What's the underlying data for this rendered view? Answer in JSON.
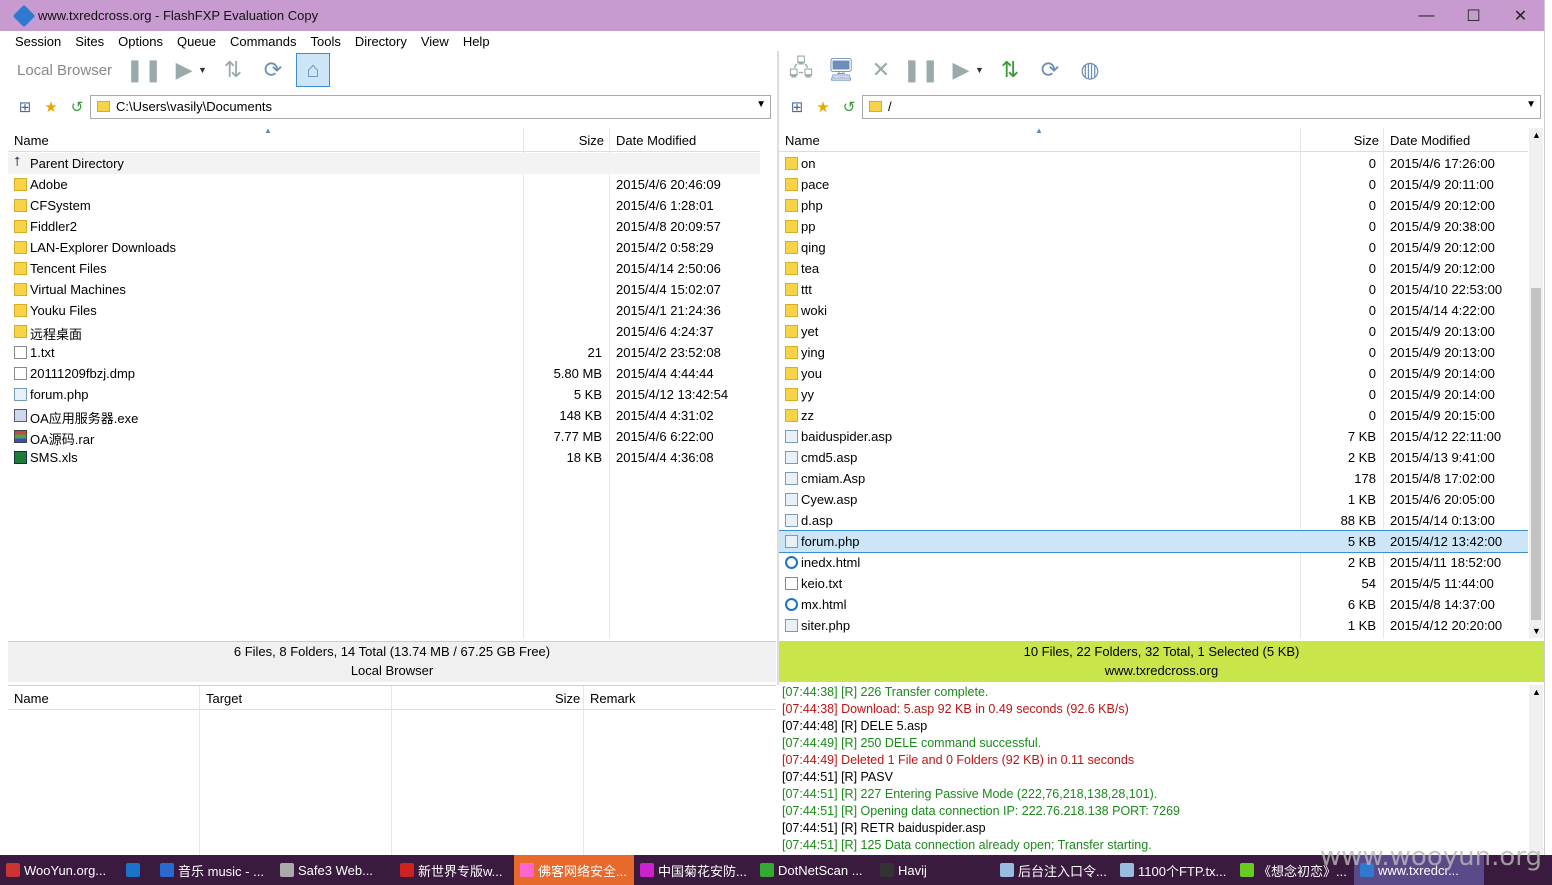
{
  "window": {
    "title": "www.txredcross.org - FlashFXP Evaluation Copy",
    "controls": [
      "—",
      "☐",
      "✕"
    ]
  },
  "menu": [
    "Session",
    "Sites",
    "Options",
    "Queue",
    "Commands",
    "Tools",
    "Directory",
    "View",
    "Help"
  ],
  "left_toolbar": {
    "label": "Local Browser"
  },
  "left_path": "C:\\Users\\vasily\\Documents",
  "right_path": "/",
  "columns": {
    "name": "Name",
    "size": "Size",
    "date": "Date Modified"
  },
  "left_files": [
    {
      "icon": "up",
      "name": "Parent Directory",
      "size": "",
      "date": ""
    },
    {
      "icon": "folder",
      "name": "Adobe",
      "size": "",
      "date": "2015/4/6 20:46:09"
    },
    {
      "icon": "folder",
      "name": "CFSystem",
      "size": "",
      "date": "2015/4/6 1:28:01"
    },
    {
      "icon": "folder",
      "name": "Fiddler2",
      "size": "",
      "date": "2015/4/8 20:09:57"
    },
    {
      "icon": "folder",
      "name": "LAN-Explorer Downloads",
      "size": "",
      "date": "2015/4/2 0:58:29"
    },
    {
      "icon": "folder",
      "name": "Tencent Files",
      "size": "",
      "date": "2015/4/14 2:50:06"
    },
    {
      "icon": "folder",
      "name": "Virtual Machines",
      "size": "",
      "date": "2015/4/4 15:02:07"
    },
    {
      "icon": "folder",
      "name": "Youku Files",
      "size": "",
      "date": "2015/4/1 21:24:36"
    },
    {
      "icon": "folder",
      "name": "远程桌面",
      "size": "",
      "date": "2015/4/6 4:24:37"
    },
    {
      "icon": "file",
      "name": "1.txt",
      "size": "21",
      "date": "2015/4/2 23:52:08"
    },
    {
      "icon": "file",
      "name": "20111209fbzj.dmp",
      "size": "5.80 MB",
      "date": "2015/4/4 4:44:44"
    },
    {
      "icon": "php",
      "name": "forum.php",
      "size": "5 KB",
      "date": "2015/4/12 13:42:54"
    },
    {
      "icon": "exe",
      "name": "OA应用服务器.exe",
      "size": "148 KB",
      "date": "2015/4/4 4:31:02"
    },
    {
      "icon": "rar",
      "name": "OA源码.rar",
      "size": "7.77 MB",
      "date": "2015/4/6 6:22:00"
    },
    {
      "icon": "xls",
      "name": "SMS.xls",
      "size": "18 KB",
      "date": "2015/4/4 4:36:08"
    }
  ],
  "right_files": [
    {
      "icon": "folder",
      "name": "on",
      "size": "0",
      "date": "2015/4/6 17:26:00"
    },
    {
      "icon": "folder",
      "name": "pace",
      "size": "0",
      "date": "2015/4/9 20:11:00"
    },
    {
      "icon": "folder",
      "name": "php",
      "size": "0",
      "date": "2015/4/9 20:12:00"
    },
    {
      "icon": "folder",
      "name": "pp",
      "size": "0",
      "date": "2015/4/9 20:38:00"
    },
    {
      "icon": "folder",
      "name": "qing",
      "size": "0",
      "date": "2015/4/9 20:12:00"
    },
    {
      "icon": "folder",
      "name": "tea",
      "size": "0",
      "date": "2015/4/9 20:12:00"
    },
    {
      "icon": "folder",
      "name": "ttt",
      "size": "0",
      "date": "2015/4/10 22:53:00"
    },
    {
      "icon": "folder",
      "name": "woki",
      "size": "0",
      "date": "2015/4/14 4:22:00"
    },
    {
      "icon": "folder",
      "name": "yet",
      "size": "0",
      "date": "2015/4/9 20:13:00"
    },
    {
      "icon": "folder",
      "name": "ying",
      "size": "0",
      "date": "2015/4/9 20:13:00"
    },
    {
      "icon": "folder",
      "name": "you",
      "size": "0",
      "date": "2015/4/9 20:14:00"
    },
    {
      "icon": "folder",
      "name": "yy",
      "size": "0",
      "date": "2015/4/9 20:14:00"
    },
    {
      "icon": "folder",
      "name": "zz",
      "size": "0",
      "date": "2015/4/9 20:15:00"
    },
    {
      "icon": "php",
      "name": "baiduspider.asp",
      "size": "7 KB",
      "date": "2015/4/12 22:11:00"
    },
    {
      "icon": "php",
      "name": "cmd5.asp",
      "size": "2 KB",
      "date": "2015/4/13 9:41:00"
    },
    {
      "icon": "php",
      "name": "cmiam.Asp",
      "size": "178",
      "date": "2015/4/8 17:02:00"
    },
    {
      "icon": "php",
      "name": "Cyew.asp",
      "size": "1 KB",
      "date": "2015/4/6 20:05:00"
    },
    {
      "icon": "php",
      "name": "d.asp",
      "size": "88 KB",
      "date": "2015/4/14 0:13:00"
    },
    {
      "icon": "php",
      "name": "forum.php",
      "size": "5 KB",
      "date": "2015/4/12 13:42:00",
      "selected": true
    },
    {
      "icon": "html",
      "name": "inedx.html",
      "size": "2 KB",
      "date": "2015/4/11 18:52:00"
    },
    {
      "icon": "file",
      "name": "keio.txt",
      "size": "54",
      "date": "2015/4/5 11:44:00"
    },
    {
      "icon": "html",
      "name": "mx.html",
      "size": "6 KB",
      "date": "2015/4/8 14:37:00"
    },
    {
      "icon": "php",
      "name": "siter.php",
      "size": "1 KB",
      "date": "2015/4/12 20:20:00"
    }
  ],
  "left_status": {
    "summary": "6 Files, 8 Folders, 14 Total (13.74 MB / 67.25 GB Free)",
    "label": "Local Browser"
  },
  "right_status": {
    "summary": "10 Files, 22 Folders, 32 Total, 1 Selected (5 KB)",
    "label": "www.txredcross.org",
    "color": "#c8e64a"
  },
  "queue_columns": {
    "name": "Name",
    "target": "Target",
    "size": "Size",
    "remark": "Remark"
  },
  "log": [
    {
      "c": "g",
      "t": "[07:44:38]  [R] 226 Transfer complete."
    },
    {
      "c": "r",
      "t": "[07:44:38]  Download: 5.asp 92 KB in 0.49 seconds (92.6 KB/s)"
    },
    {
      "c": "k",
      "t": "[07:44:48]  [R] DELE 5.asp"
    },
    {
      "c": "g",
      "t": "[07:44:49]  [R] 250 DELE command successful."
    },
    {
      "c": "r",
      "t": "[07:44:49]  Deleted 1 File and 0 Folders (92 KB) in 0.11 seconds"
    },
    {
      "c": "k",
      "t": "[07:44:51]  [R] PASV"
    },
    {
      "c": "g",
      "t": "[07:44:51]  [R] 227 Entering Passive Mode (222,76,218,138,28,101)."
    },
    {
      "c": "g",
      "t": "[07:44:51]  [R] Opening data connection IP: 222.76.218.138 PORT: 7269"
    },
    {
      "c": "k",
      "t": "[07:44:51]  [R] RETR baiduspider.asp"
    },
    {
      "c": "g",
      "t": "[07:44:51]  [R] 125 Data connection already open; Transfer starting."
    }
  ],
  "taskbar": [
    {
      "label": "WooYun.org...",
      "color": "#c33",
      "w": 120
    },
    {
      "label": "",
      "color": "#1a73c8",
      "w": 34
    },
    {
      "label": "音乐 music - ...",
      "color": "#2a6ad0",
      "w": 120
    },
    {
      "label": "Safe3 Web...",
      "color": "#aaa",
      "w": 120
    },
    {
      "label": "新世界专版w...",
      "color": "#c22",
      "w": 120
    },
    {
      "label": "佛客网络安全...",
      "color": "#f6c",
      "w": 120,
      "active": true
    },
    {
      "label": "中国菊花安防...",
      "color": "#c2c",
      "w": 120
    },
    {
      "label": "DotNetScan ...",
      "color": "#3a3",
      "w": 120
    },
    {
      "label": "Havij",
      "color": "#333",
      "w": 120
    },
    {
      "label": "后台注入口令...",
      "color": "#9bd",
      "w": 120
    },
    {
      "label": "1100个FTP.tx...",
      "color": "#9bd",
      "w": 120
    },
    {
      "label": "《想念初恋》...",
      "color": "#6c2",
      "w": 120
    },
    {
      "label": "www.txredcr...",
      "color": "#2f7ad0",
      "w": 130,
      "cur": true
    }
  ],
  "watermark": "www.wooyun.org"
}
